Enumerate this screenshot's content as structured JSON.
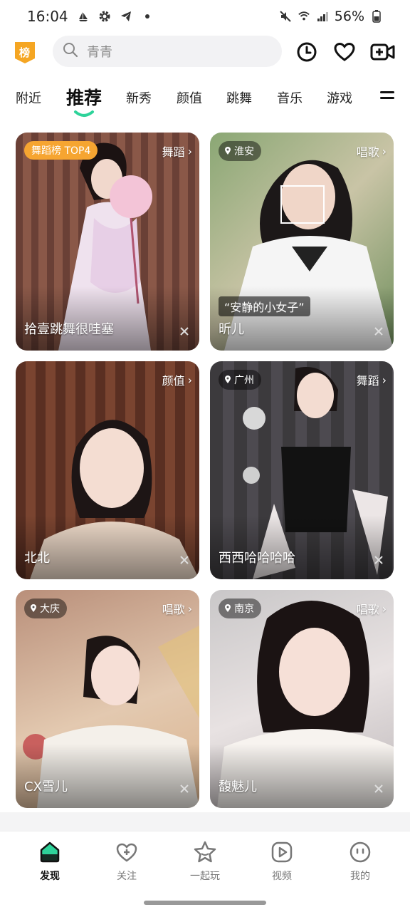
{
  "status_bar": {
    "time": "16:04",
    "battery": "56%"
  },
  "search": {
    "placeholder": "青青"
  },
  "logo": {
    "text": "榜"
  },
  "tabs": [
    {
      "label": "附近",
      "active": false
    },
    {
      "label": "推荐",
      "active": true
    },
    {
      "label": "新秀",
      "active": false
    },
    {
      "label": "颜值",
      "active": false
    },
    {
      "label": "跳舞",
      "active": false
    },
    {
      "label": "音乐",
      "active": false
    },
    {
      "label": "游戏",
      "active": false
    }
  ],
  "cards": [
    {
      "name": "拾壹跳舞很哇塞",
      "category": "舞蹈",
      "badge": "舞蹈榜 TOP4"
    },
    {
      "name": "昕儿",
      "category": "唱歌",
      "location": "淮安",
      "caption": "“安静的小女子”"
    },
    {
      "name": "北北",
      "category": "颜值"
    },
    {
      "name": "西西哈哈哈哈",
      "category": "舞蹈",
      "location": "广州"
    },
    {
      "name": "CX雪儿",
      "category": "唱歌",
      "location": "大庆"
    },
    {
      "name": "馥魅儿",
      "category": "唱歌",
      "location": "南京"
    }
  ],
  "bottom_nav": [
    {
      "label": "发现",
      "active": true
    },
    {
      "label": "关注",
      "active": false
    },
    {
      "label": "一起玩",
      "active": false
    },
    {
      "label": "视频",
      "active": false
    },
    {
      "label": "我的",
      "active": false
    }
  ],
  "colors": {
    "accent_green": "#2ed39a",
    "badge_orange": "#f6a531",
    "logo_orange": "#f5a623"
  }
}
